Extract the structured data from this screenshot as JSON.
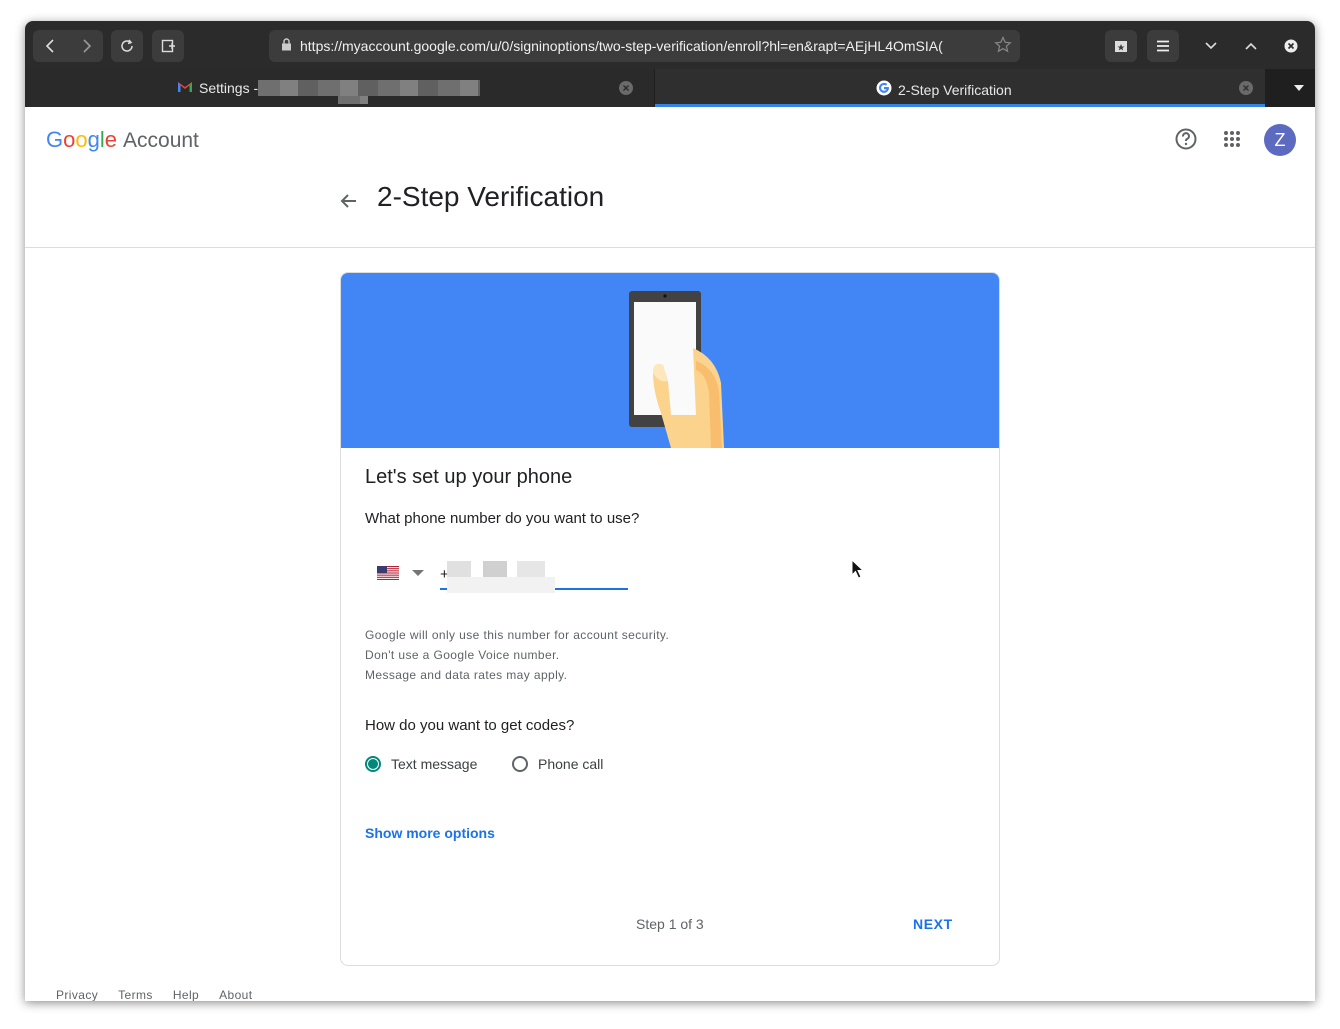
{
  "browser": {
    "url": "https://myaccount.google.com/u/0/signinoptions/two-step-verification/enroll?hl=en&rapt=AEjHL4OmSIA(",
    "tabs": [
      {
        "title": "Settings -",
        "icon": "gmail-icon",
        "active": false
      },
      {
        "title": "2-Step Verification",
        "icon": "google-g-icon",
        "active": true
      }
    ]
  },
  "header": {
    "logo_letters": [
      "G",
      "o",
      "o",
      "g",
      "l",
      "e"
    ],
    "logo_suffix": "Account",
    "avatar_initial": "Z"
  },
  "page": {
    "title": "2-Step Verification"
  },
  "card": {
    "heading": "Let's set up your phone",
    "phone_question": "What phone number do you want to use?",
    "phone_value": "+",
    "notes": [
      "Google will only use this number for account security.",
      "Don't use a Google Voice number.",
      "Message and data rates may apply."
    ],
    "codes_question": "How do you want to get codes?",
    "options": [
      {
        "label": "Text message",
        "selected": true
      },
      {
        "label": "Phone call",
        "selected": false
      }
    ],
    "show_more": "Show more options",
    "step": "Step 1 of 3",
    "next": "NEXT"
  },
  "footer": {
    "links": [
      "Privacy",
      "Terms",
      "Help",
      "About"
    ]
  },
  "colors": {
    "brand_blue": "#4285f4",
    "link_blue": "#1a73e8",
    "radio_teal": "#00897b",
    "avatar": "#5c6bc0"
  }
}
